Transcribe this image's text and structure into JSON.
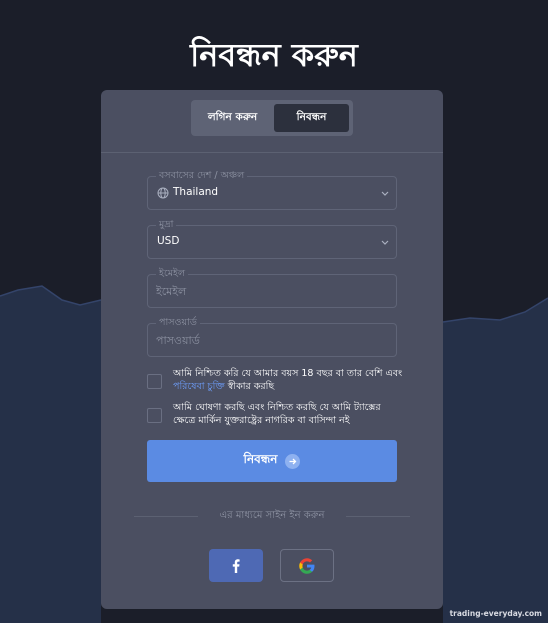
{
  "page": {
    "title": "নিবন্ধন করুন"
  },
  "tabs": [
    {
      "label": "লগিন করুন",
      "active": false
    },
    {
      "label": "নিবন্ধন",
      "active": true
    }
  ],
  "form": {
    "country": {
      "label": "বসবাসের দেশ / অঞ্চল",
      "value": "Thailand",
      "icon": "globe-icon"
    },
    "currency": {
      "label": "মুদ্রা",
      "value": "USD"
    },
    "email": {
      "label": "ইমেইল",
      "placeholder": "ইমেইল",
      "value": ""
    },
    "password": {
      "label": "পাসওয়ার্ড",
      "placeholder": "পাসওয়ার্ড",
      "value": ""
    },
    "age_check": {
      "text_before": "আমি নিশ্চিত করি যে আমার বয়স 18 বছর বা তার বেশি এবং ",
      "link": "পরিষেবা চুক্তি",
      "text_after": " স্বীকার করছি",
      "checked": false
    },
    "tax_check": {
      "text": "আমি ঘোষণা করছি এবং নিশ্চিত করছি যে আমি ট্যাক্সের ক্ষেত্রে মার্কিন যুক্তরাষ্ট্রের নাগরিক বা বাসিন্দা নই",
      "checked": false
    },
    "submit": {
      "label": "নিবন্ধন",
      "icon": "arrow-right-icon"
    }
  },
  "social": {
    "divider_text": "এর মাধ্যমে সাইন ইন করুন",
    "buttons": [
      {
        "icon": "facebook-icon",
        "color": "#4e69b4"
      },
      {
        "icon": "google-icon"
      }
    ]
  },
  "watermark": "trading-everyday.com",
  "colors": {
    "background": "#1b1e29",
    "card": "#4b4f61",
    "accent": "#5b8be3",
    "link": "#6fa0ff"
  }
}
